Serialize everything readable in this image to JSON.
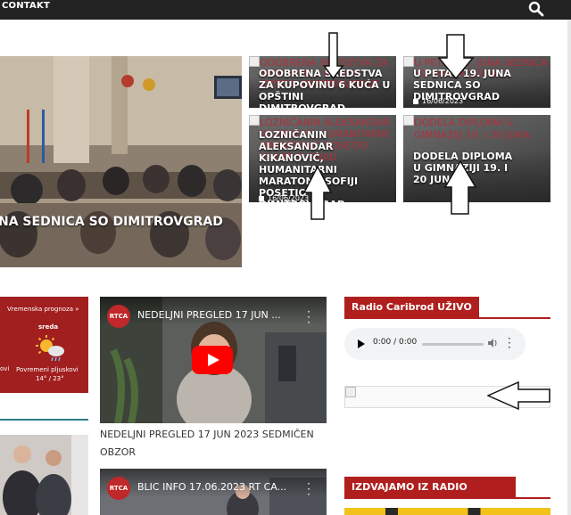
{
  "nav": {
    "contact": "CONTAKT"
  },
  "hero": {
    "title": "NA SEDNICA SO DIMITROVGRAD"
  },
  "cards": [
    {
      "alt": "ODOBRENA SREDSTVA ZA KUPOVINU 6 KUĆA U OPŠTINI DIMITROVGRAD",
      "title": "ODOBRENA SREDSTVA ZA KUPOVINU 6 KUĆA U OPŠTINI DIMITROVGRAD",
      "date": ""
    },
    {
      "alt": "U PETAK 19. JUNA SEDNICA SO DIMITROVGRAD",
      "title": "U PETAK 19. JUNA SEDNICA SO DIMITROVGRAD",
      "date": "16/06/2023"
    },
    {
      "alt": "LOZNIČANIN ALEKSANDAR KIKANOVIĆ, HUMANITARNI MARATONAC POSETIO DIMITROVGRAD",
      "title": "LOZNIČANIN ALEKSANDAR KIKANOVIĆ, HUMANITARNI MARATONA SOFIJI POSETIO DIMITROVGRAD",
      "date": "16/06/2023"
    },
    {
      "alt": "DODELA DIPLOMA U GIMNAZIJI 19. I 20 JUNA",
      "title": "DODELA DIPLOMA U GIMNAZIJI 19. I 20 JUNA",
      "date": ""
    }
  ],
  "weather": {
    "title": "Vremenska prognoza »",
    "day": "sreda",
    "left_label": "ovi",
    "desc": "Povremeni pljuskovi",
    "temp": "14° / 23°"
  },
  "videos": [
    {
      "channel_logo": "RTCA",
      "title": "NEDELJNI PREGLED 17 JUN ...",
      "caption": "NEDELJNI PREGLED 17 JUN 2023 SEDMIČEN OBZOR"
    },
    {
      "channel_logo": "RTCA",
      "title": "BLIC INFO 17.06.2023 RT CA..."
    }
  ],
  "radio": {
    "title": "Radio Caribrod UŽIVO",
    "time": "0:00 / 0:00"
  },
  "program": {
    "title": "IZDVAJAMO IZ RADIO PROGRAMA"
  },
  "colors": {
    "brand_red": "#b01e1e",
    "teal": "#2b7d87",
    "dark_bar": "#222222"
  },
  "icons": {
    "search": "search-icon",
    "play": "play-icon",
    "volume": "volume-icon",
    "more": "more-vert-icon"
  }
}
